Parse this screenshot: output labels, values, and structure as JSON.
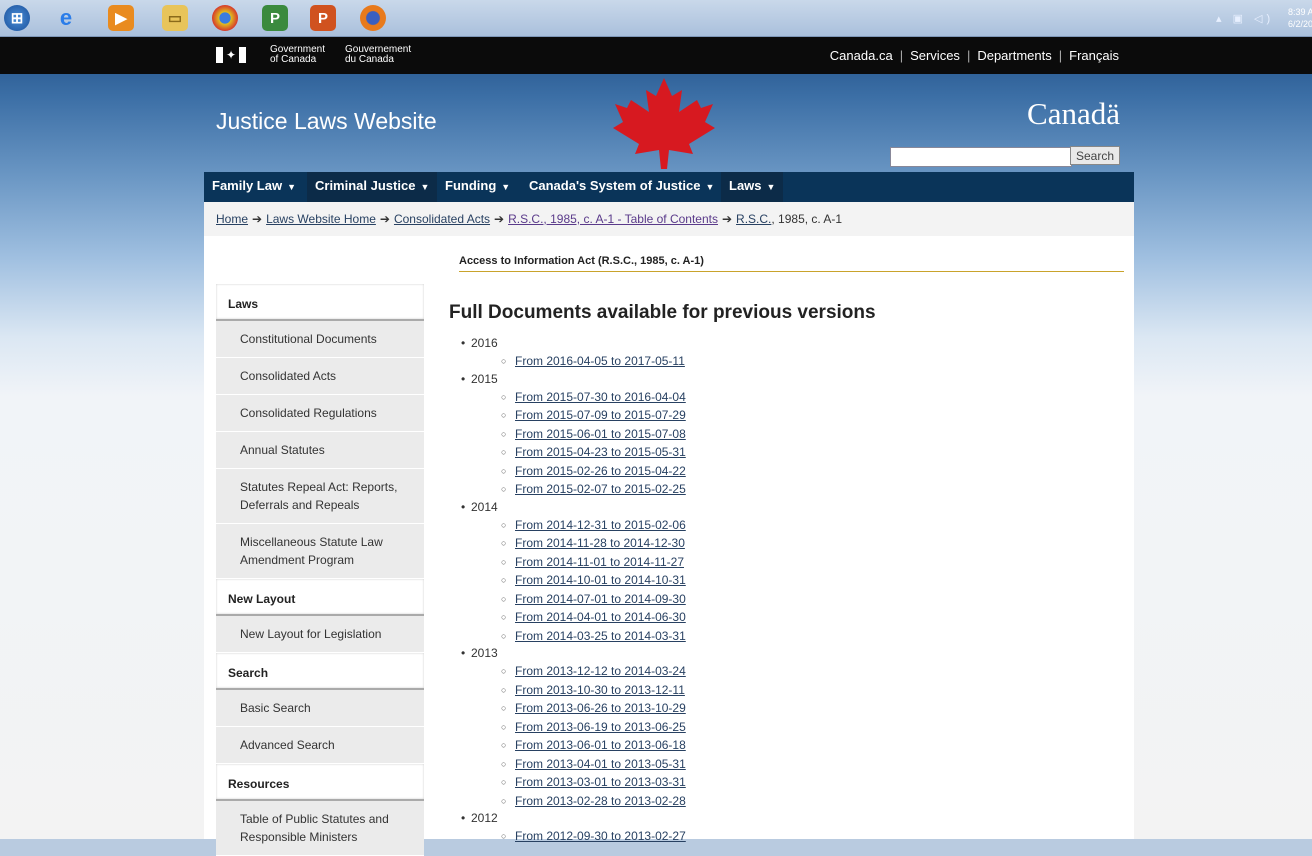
{
  "taskbar": {
    "icons": [
      "windows-start-icon",
      "ie-icon",
      "media-player-icon",
      "folder-icon",
      "chrome-icon",
      "project-icon",
      "powerpoint-icon",
      "firefox-icon"
    ],
    "clock_time": "8:39 A",
    "clock_date": "6/2/20"
  },
  "goc": {
    "name_en_1": "Government",
    "name_en_2": "of Canada",
    "name_fr_1": "Gouvernement",
    "name_fr_2": "du Canada",
    "links": [
      "Canada.ca",
      "Services",
      "Departments",
      "Français"
    ]
  },
  "banner": {
    "site_title": "Justice Laws Website",
    "wordmark": "Canadä",
    "search_placeholder": "",
    "search_button": "Search"
  },
  "menu": [
    {
      "label": "Family Law"
    },
    {
      "label": "Criminal Justice"
    },
    {
      "label": "Funding"
    },
    {
      "label": "Canada's System of Justice"
    },
    {
      "label": "Laws"
    }
  ],
  "breadcrumb": {
    "items": [
      "Home",
      "Laws Website Home",
      "Consolidated Acts",
      "R.S.C., 1985, c. A-1 -  Table of Contents"
    ],
    "current_link": "R.S.C.",
    "current_rest": ", 1985, c. A-1"
  },
  "act_title": "Access to Information Act (R.S.C., 1985, c. A-1)",
  "sidebar": {
    "laws_head": "Laws",
    "laws": [
      "Constitutional Documents",
      "Consolidated Acts",
      "Consolidated Regulations",
      "Annual Statutes",
      "Statutes Repeal Act: Reports, Deferrals and Repeals",
      "Miscellaneous Statute Law Amendment Program"
    ],
    "layout_head": "New Layout",
    "layout": [
      "New Layout for Legislation"
    ],
    "search_head": "Search",
    "search": [
      "Basic Search",
      "Advanced Search"
    ],
    "resources_head": "Resources",
    "resources": [
      "Table of Public Statutes and Responsible Ministers"
    ]
  },
  "main": {
    "heading": "Full Documents available for previous versions",
    "years": [
      {
        "year": "2016",
        "versions": [
          "From 2016-04-05 to 2017-05-11"
        ]
      },
      {
        "year": "2015",
        "versions": [
          "From 2015-07-30 to 2016-04-04",
          "From 2015-07-09 to 2015-07-29",
          "From 2015-06-01 to 2015-07-08",
          "From 2015-04-23 to 2015-05-31",
          "From 2015-02-26 to 2015-04-22",
          "From 2015-02-07 to 2015-02-25"
        ]
      },
      {
        "year": "2014",
        "versions": [
          "From 2014-12-31 to 2015-02-06",
          "From 2014-11-28 to 2014-12-30",
          "From 2014-11-01 to 2014-11-27",
          "From 2014-10-01 to 2014-10-31",
          "From 2014-07-01 to 2014-09-30",
          "From 2014-04-01 to 2014-06-30",
          "From 2014-03-25 to 2014-03-31"
        ]
      },
      {
        "year": "2013",
        "versions": [
          "From 2013-12-12 to 2014-03-24",
          "From 2013-10-30 to 2013-12-11",
          "From 2013-06-26 to 2013-10-29",
          "From 2013-06-19 to 2013-06-25",
          "From 2013-06-01 to 2013-06-18",
          "From 2013-04-01 to 2013-05-31",
          "From 2013-03-01 to 2013-03-31",
          "From 2013-02-28 to 2013-02-28"
        ]
      },
      {
        "year": "2012",
        "versions": [
          "From 2012-09-30 to 2013-02-27"
        ]
      }
    ]
  },
  "colors": {
    "menu_bg": "#0a3459",
    "goc_bar": "#0b0b0b",
    "link": "#284162",
    "accent_rule": "#c9a32b",
    "maple": "#d71920"
  }
}
